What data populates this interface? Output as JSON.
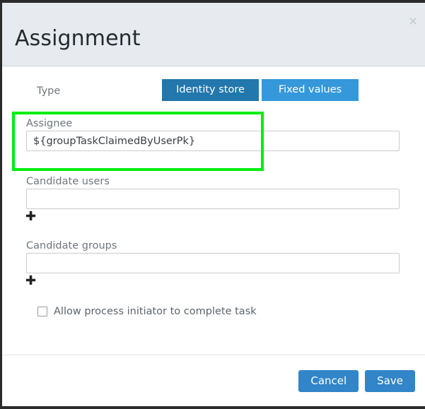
{
  "dialog": {
    "title": "Assignment",
    "close_icon": "close-icon",
    "close_label": "×"
  },
  "type_row": {
    "label": "Type",
    "options": [
      {
        "label": "Identity store",
        "active": true
      },
      {
        "label": "Fixed values",
        "active": false
      }
    ]
  },
  "fields": {
    "assignee": {
      "label": "Assignee",
      "value": "${groupTaskClaimedByUserPk}",
      "placeholder": ""
    },
    "candidate_users": {
      "label": "Candidate users",
      "value": "",
      "placeholder": "",
      "add_icon": "plus-icon"
    },
    "candidate_groups": {
      "label": "Candidate groups",
      "value": "",
      "placeholder": "",
      "add_icon": "plus-icon"
    }
  },
  "checkbox": {
    "label": "Allow process initiator to complete task",
    "checked": false
  },
  "footer": {
    "cancel_label": "Cancel",
    "save_label": "Save"
  },
  "colors": {
    "header_bg": "#e7ebf0",
    "accent_blue": "#3185c8",
    "active_blue": "#2277ac",
    "inactive_blue": "#3498db",
    "highlight_green": "#00ee11"
  }
}
